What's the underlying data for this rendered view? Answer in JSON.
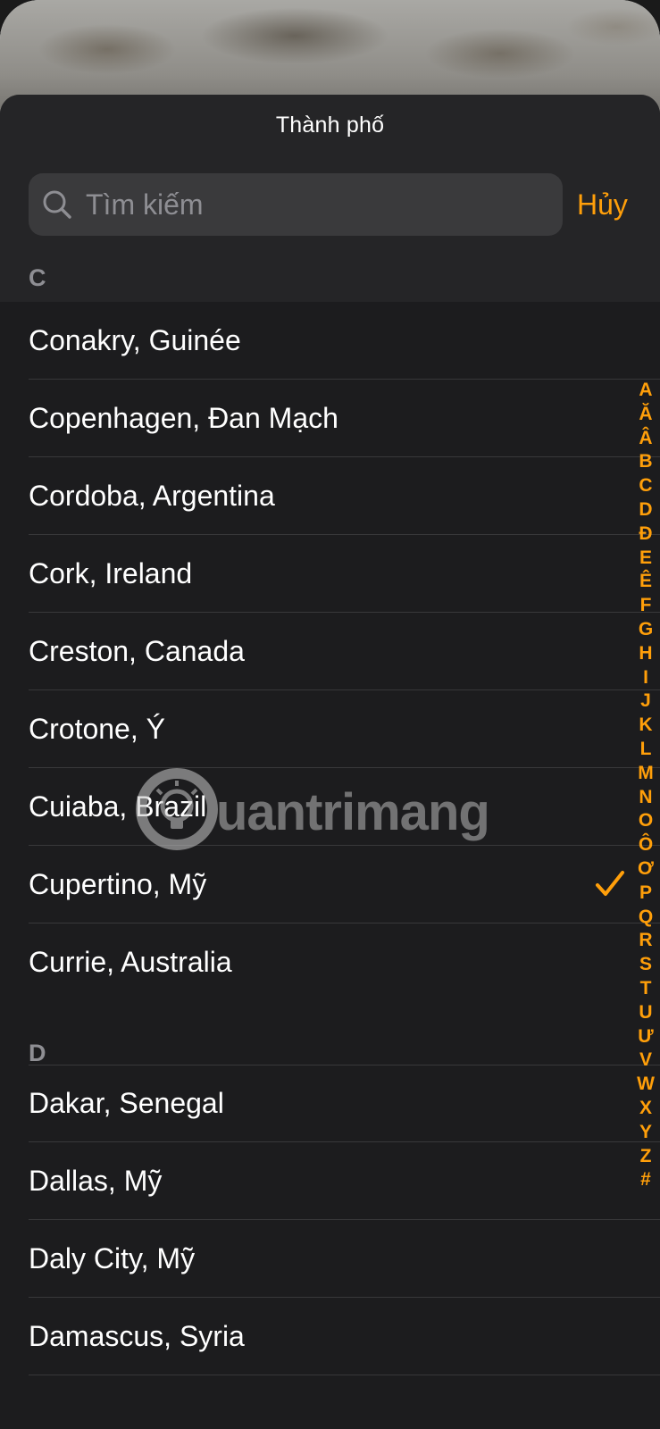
{
  "sheet": {
    "title": "Thành phố"
  },
  "search": {
    "placeholder": "Tìm kiếm",
    "value": "",
    "cancel_label": "Hủy"
  },
  "sections": [
    {
      "letter": "C",
      "cities": [
        {
          "name": "Conakry, Guinée",
          "selected": false
        },
        {
          "name": "Copenhagen, Đan Mạch",
          "selected": false
        },
        {
          "name": "Cordoba, Argentina",
          "selected": false
        },
        {
          "name": "Cork, Ireland",
          "selected": false
        },
        {
          "name": "Creston, Canada",
          "selected": false
        },
        {
          "name": "Crotone, Ý",
          "selected": false
        },
        {
          "name": "Cuiaba, Brazil",
          "selected": false
        },
        {
          "name": "Cupertino, Mỹ",
          "selected": true
        },
        {
          "name": "Currie, Australia",
          "selected": false
        }
      ]
    },
    {
      "letter": "D",
      "cities": [
        {
          "name": "Dakar, Senegal",
          "selected": false
        },
        {
          "name": "Dallas, Mỹ",
          "selected": false
        },
        {
          "name": "Daly City, Mỹ",
          "selected": false
        },
        {
          "name": "Damascus, Syria",
          "selected": false
        }
      ]
    }
  ],
  "index_letters": [
    "A",
    "Ă",
    "Â",
    "B",
    "C",
    "D",
    "Đ",
    "E",
    "Ê",
    "F",
    "G",
    "H",
    "I",
    "J",
    "K",
    "L",
    "M",
    "N",
    "O",
    "Ô",
    "Ơ",
    "P",
    "Q",
    "R",
    "S",
    "T",
    "U",
    "Ư",
    "V",
    "W",
    "X",
    "Y",
    "Z",
    "#"
  ],
  "watermark": {
    "text": "uantrimang"
  },
  "colors": {
    "accent": "#ff9f0a",
    "sheet_background": "#1c1c1e",
    "header_background": "#252527",
    "separator": "#38383a",
    "secondary_text": "#8e8e93"
  },
  "icons": {
    "search": "magnifying-glass-icon",
    "selected": "checkmark-icon",
    "watermark_logo": "lightbulb-icon"
  }
}
